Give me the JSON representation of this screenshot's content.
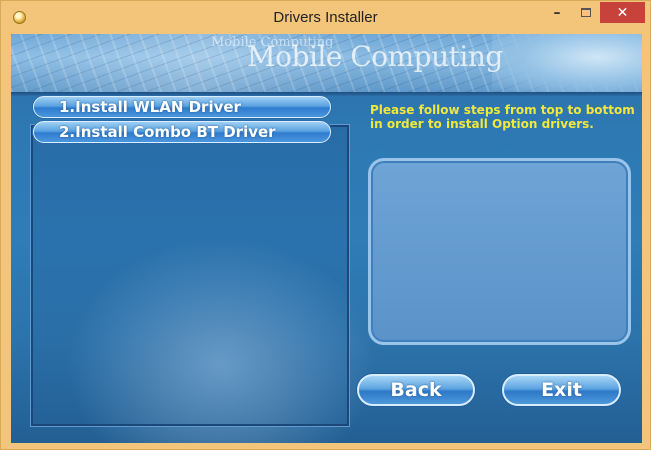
{
  "window": {
    "title": "Drivers Installer",
    "minimize_glyph": "–",
    "close_glyph": "✕"
  },
  "banner": {
    "small_text": "Mobile Computing",
    "big_text": "Mobile Computing"
  },
  "drivers": [
    {
      "label": "1.Install WLAN Driver"
    },
    {
      "label": "2.Install Combo BT Driver"
    }
  ],
  "instructions": "Please follow steps from top to bottom in order to install Option drivers.",
  "buttons": {
    "back": "Back",
    "exit": "Exit"
  },
  "colors": {
    "title_bar": "#f3c57a",
    "close_button": "#c7423a",
    "instruction_text": "#f1e83a",
    "background": "#2f7cb7"
  },
  "icons": {
    "app": "app-icon",
    "minimize": "minimize-icon",
    "maximize": "maximize-icon",
    "close": "close-icon"
  }
}
